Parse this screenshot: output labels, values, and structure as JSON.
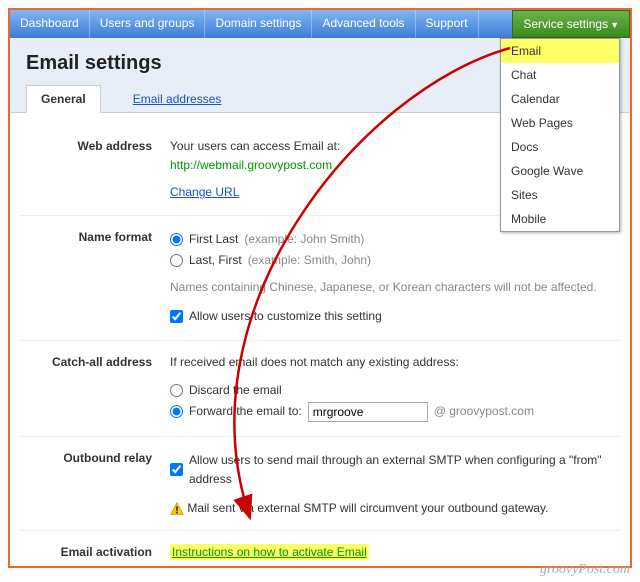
{
  "nav": {
    "items": [
      "Dashboard",
      "Users and groups",
      "Domain settings",
      "Advanced tools",
      "Support"
    ],
    "service": "Service settings"
  },
  "dropdown": [
    "Email",
    "Chat",
    "Calendar",
    "Web Pages",
    "Docs",
    "Google Wave",
    "Sites",
    "Mobile"
  ],
  "page_title": "Email settings",
  "tabs": {
    "general": "General",
    "addresses": "Email addresses"
  },
  "web_address": {
    "label": "Web address",
    "intro": "Your users can access Email at:",
    "url": "http://webmail.groovypost.com",
    "change": "Change URL"
  },
  "name_format": {
    "label": "Name format",
    "opt1": "First Last",
    "opt1_ex": "(example: John Smith)",
    "opt2": "Last, First",
    "opt2_ex": "(example: Smith, John)",
    "note": "Names containing Chinese, Japanese, or Korean characters will not be affected.",
    "allow": "Allow users to customize this setting"
  },
  "catch_all": {
    "label": "Catch-all address",
    "intro": "If received email does not match any existing address:",
    "opt1": "Discard the email",
    "opt2": "Forward the email to:",
    "value": "mrgroove",
    "suffix": "@ groovypost.com"
  },
  "outbound": {
    "label": "Outbound relay",
    "allow": "Allow users to send mail through an external SMTP when configuring a \"from\" address",
    "warn": "Mail sent via external SMTP will circumvent your outbound gateway."
  },
  "activation": {
    "label": "Email activation",
    "link": "Instructions on how to activate Email"
  },
  "watermark": "groovyPost.com"
}
